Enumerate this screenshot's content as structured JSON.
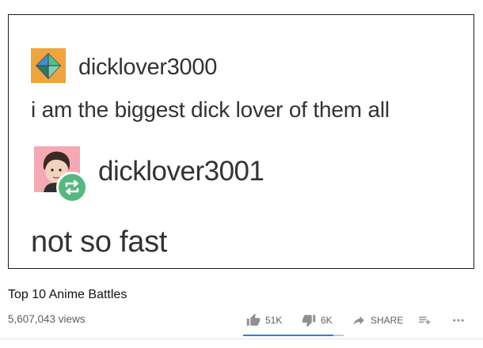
{
  "post": {
    "original": {
      "username": "dicklover3000",
      "text": "i am the biggest dick lover of them all",
      "avatar_icon": "diamond-logo-icon"
    },
    "reblog": {
      "username": "dicklover3001",
      "text": "not so fast",
      "avatar_icon": "cartoon-face-icon",
      "badge_icon": "reblog-icon"
    }
  },
  "video": {
    "title": "Top 10 Anime Battles",
    "views": "5,607,043 views"
  },
  "actions": {
    "like_count": "51K",
    "dislike_count": "6K",
    "share_label": "SHARE",
    "like_ratio": 0.895
  },
  "colors": {
    "accent": "#2f7de1",
    "reblog_green": "#56b77f",
    "avatar_orange": "#f0a43c",
    "avatar_pink": "#f4a9b4"
  }
}
